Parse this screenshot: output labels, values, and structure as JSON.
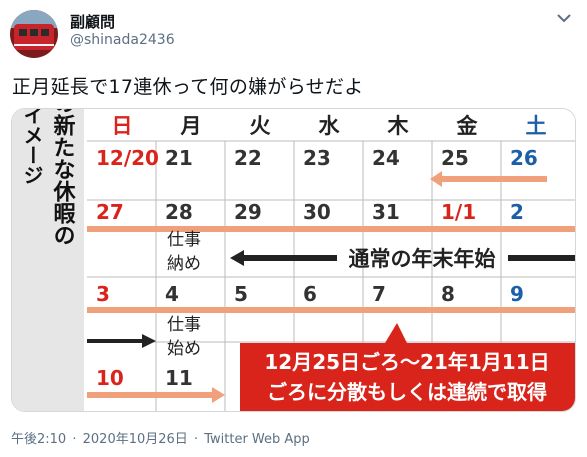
{
  "tweet": {
    "display_name": "副顧問",
    "handle": "@shinada2436",
    "text": "正月延長で17連休って何の嫌がらせだよ",
    "time": "午後2:10",
    "date": "2020年10月26日",
    "source": "Twitter Web App",
    "dot": "·"
  },
  "calendar": {
    "side_title": [
      "年末年始の新たな休暇の",
      "取得イメージ"
    ],
    "weekdays": [
      "日",
      "月",
      "火",
      "水",
      "木",
      "金",
      "土"
    ],
    "rows": [
      [
        "12/20",
        "21",
        "22",
        "23",
        "24",
        "25",
        "26"
      ],
      [
        "27",
        "28",
        "29",
        "30",
        "31",
        "1/1",
        "2"
      ],
      [
        "3",
        "4",
        "5",
        "6",
        "7",
        "8",
        "9"
      ],
      [
        "10",
        "11",
        "",
        "",
        "",
        "",
        ""
      ]
    ],
    "shigoto_osame": [
      "仕事",
      "納め"
    ],
    "shigoto_hajime": [
      "仕事",
      "始め"
    ],
    "normal_holiday_label": "通常の年末年始",
    "callout_line1": "12月25日ごろ〜21年1月11日",
    "callout_line2": "ごろに分散もしくは連続で取得",
    "colors": {
      "sunday": "#d9241c",
      "saturday": "#1a5fa8",
      "holiday": "#d9241c",
      "number": "#333333",
      "orange_band": "#f0a07a",
      "callout_bg": "#d9241c",
      "side_panel": "#e6e6e6"
    }
  }
}
